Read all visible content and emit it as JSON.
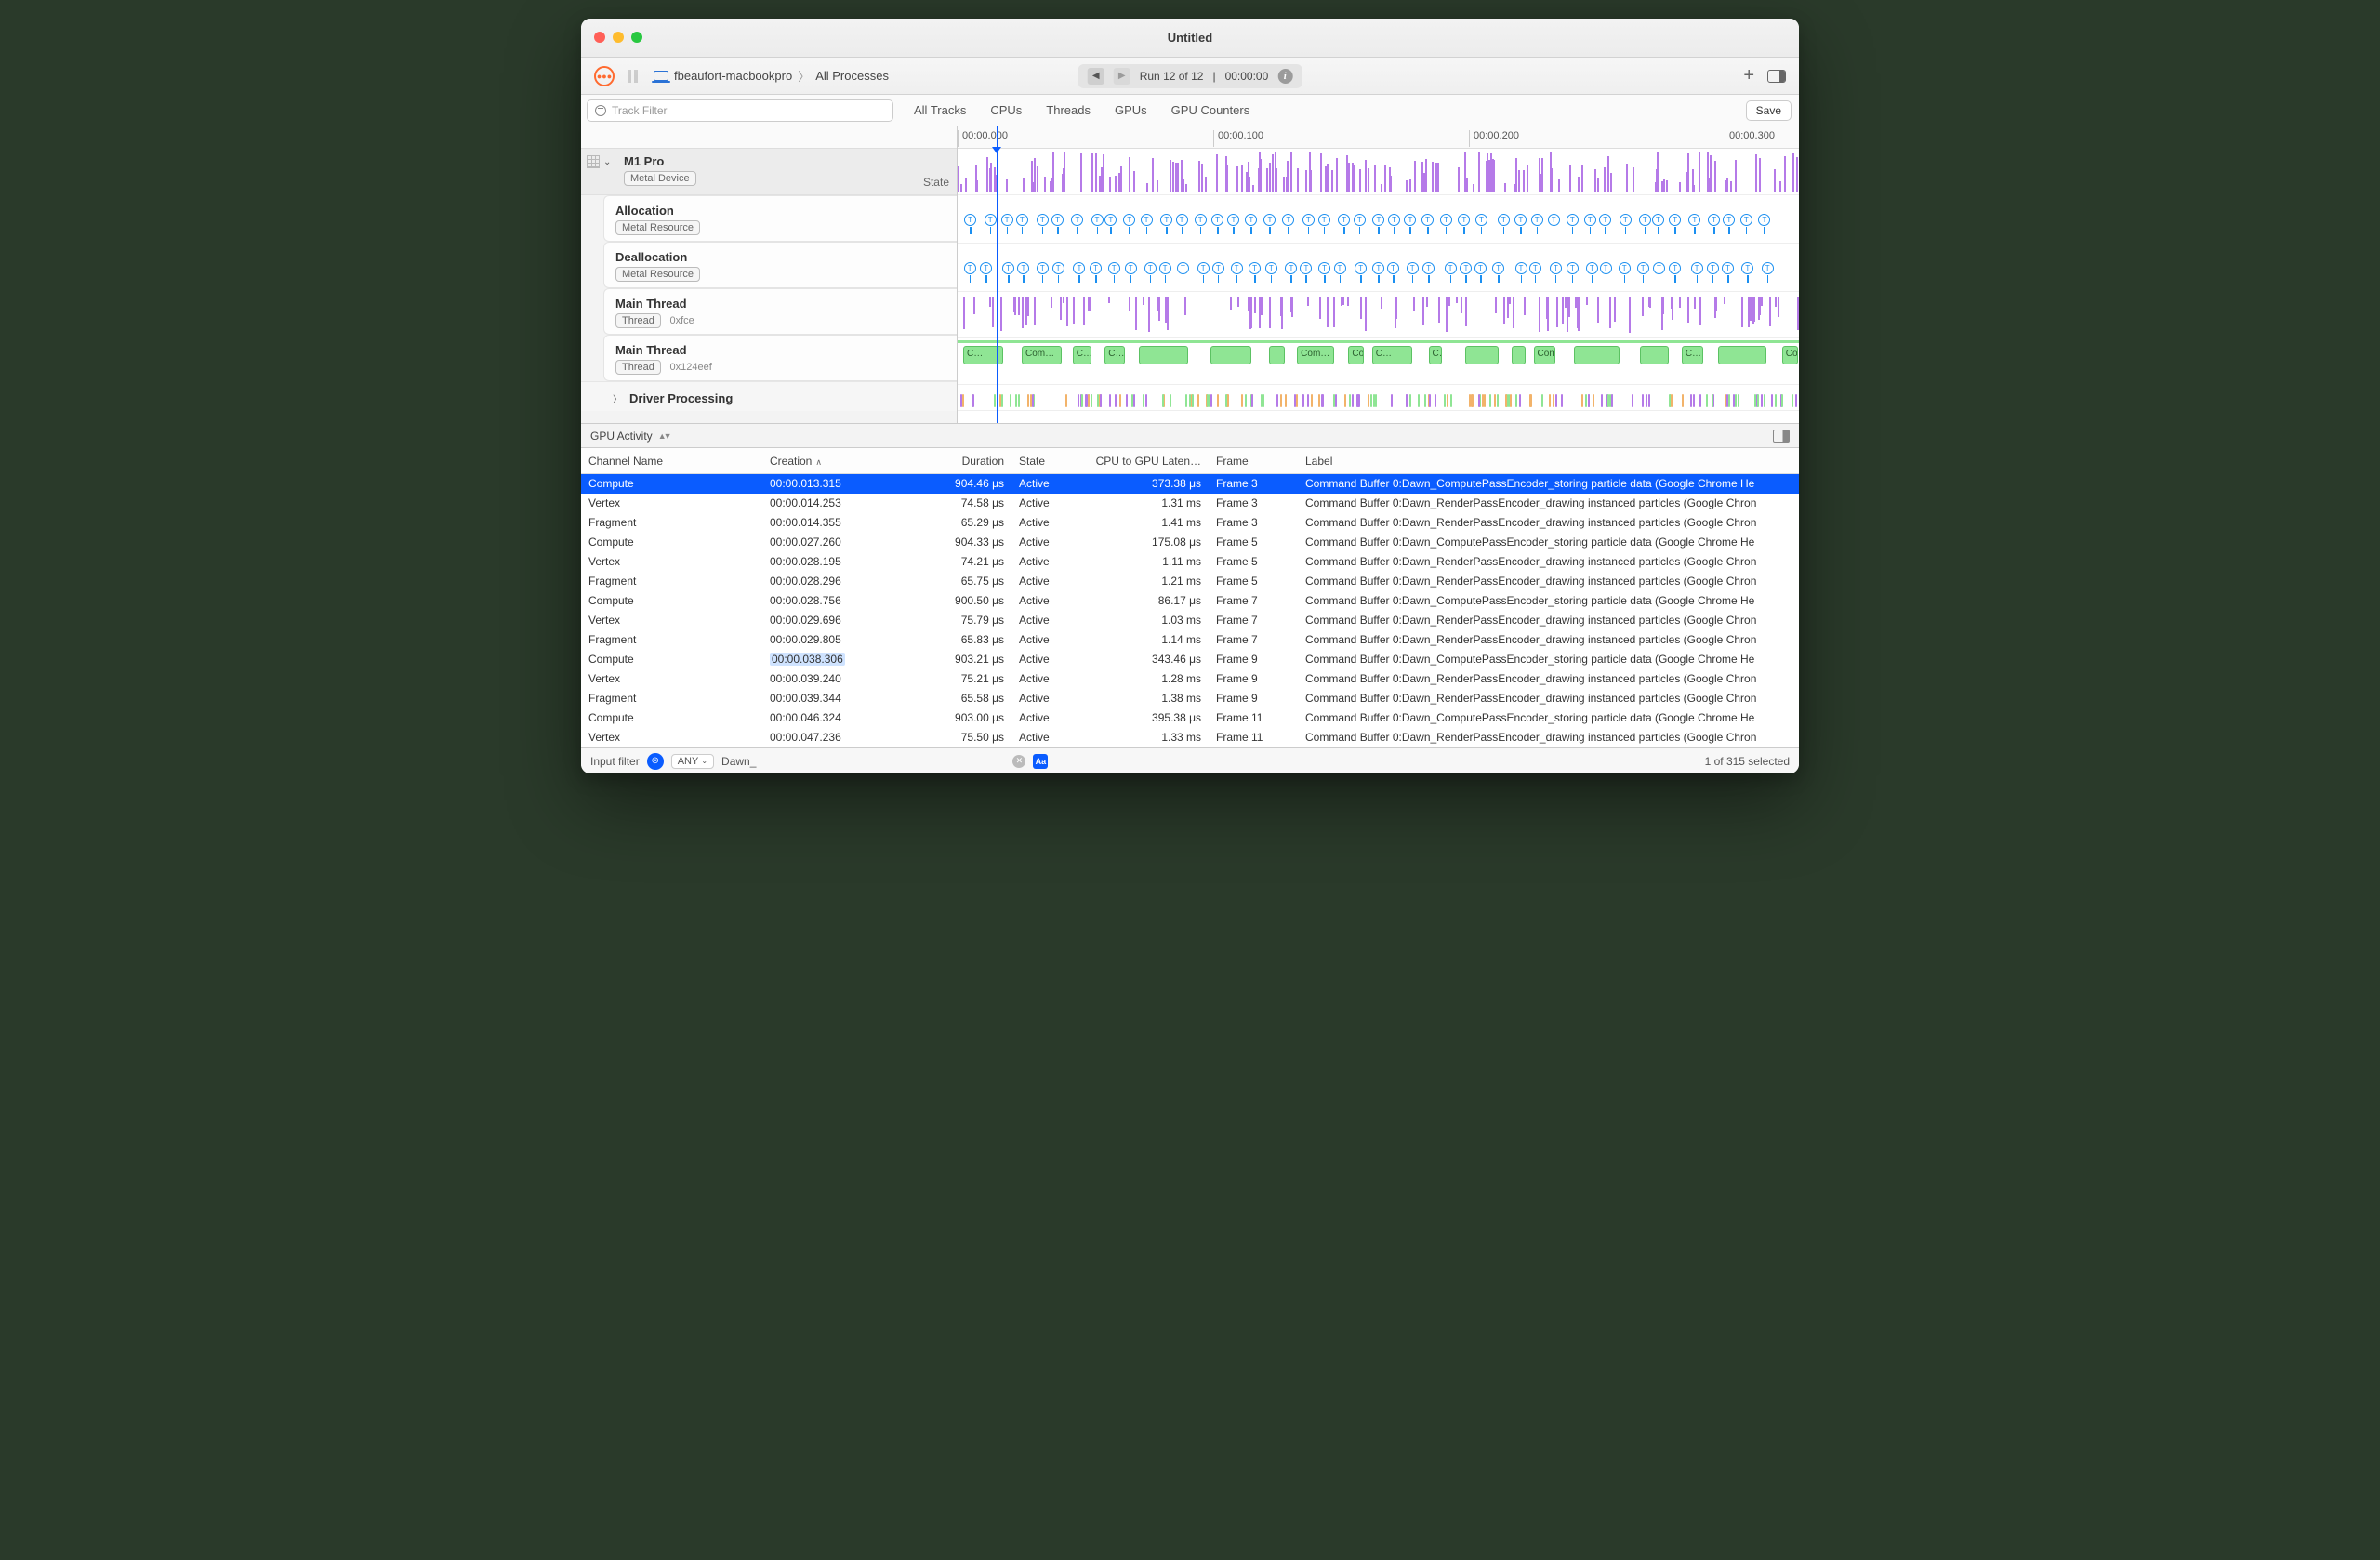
{
  "window": {
    "title": "Untitled"
  },
  "toolbar": {
    "machine": "fbeaufort-macbookpro",
    "scope": "All Processes",
    "run_label": "Run 12 of 12",
    "run_time": "00:00:00",
    "plus": "+"
  },
  "filterbar": {
    "placeholder": "Track Filter",
    "tabs": [
      "All Tracks",
      "CPUs",
      "Threads",
      "GPUs",
      "GPU Counters"
    ],
    "save": "Save"
  },
  "ruler": {
    "ticks": [
      "00:00.000",
      "00:00.100",
      "00:00.200",
      "00:00.300"
    ]
  },
  "sidebar": {
    "device": "M1 Pro",
    "device_pill": "Metal Device",
    "state": "State",
    "tracks": [
      {
        "title": "Allocation",
        "pill": "Metal Resource"
      },
      {
        "title": "Deallocation",
        "pill": "Metal Resource"
      },
      {
        "title": "Main Thread",
        "pill": "Thread",
        "sub": "0xfce"
      },
      {
        "title": "Main Thread",
        "pill": "Thread",
        "sub": "0x124eef"
      }
    ],
    "driver": "Driver Processing"
  },
  "selector": {
    "label": "GPU Activity"
  },
  "columns": {
    "channel": "Channel Name",
    "creation": "Creation",
    "duration": "Duration",
    "state": "State",
    "latency": "CPU to GPU Laten…",
    "frame": "Frame",
    "label": "Label"
  },
  "rows": [
    {
      "ch": "Compute",
      "cr": "00:00.013.315",
      "du": "904.46 μs",
      "st": "Active",
      "la": "373.38 μs",
      "fr": "Frame 3",
      "lb": "Command Buffer 0:Dawn_ComputePassEncoder_storing particle data   (Google Chrome He",
      "sel": true
    },
    {
      "ch": "Vertex",
      "cr": "00:00.014.253",
      "du": "74.58 μs",
      "st": "Active",
      "la": "1.31 ms",
      "fr": "Frame 3",
      "lb": "Command Buffer 0:Dawn_RenderPassEncoder_drawing instanced particles   (Google Chron"
    },
    {
      "ch": "Fragment",
      "cr": "00:00.014.355",
      "du": "65.29 μs",
      "st": "Active",
      "la": "1.41 ms",
      "fr": "Frame 3",
      "lb": "Command Buffer 0:Dawn_RenderPassEncoder_drawing instanced particles   (Google Chron"
    },
    {
      "ch": "Compute",
      "cr": "00:00.027.260",
      "du": "904.33 μs",
      "st": "Active",
      "la": "175.08 μs",
      "fr": "Frame 5",
      "lb": "Command Buffer 0:Dawn_ComputePassEncoder_storing particle data   (Google Chrome He"
    },
    {
      "ch": "Vertex",
      "cr": "00:00.028.195",
      "du": "74.21 μs",
      "st": "Active",
      "la": "1.11 ms",
      "fr": "Frame 5",
      "lb": "Command Buffer 0:Dawn_RenderPassEncoder_drawing instanced particles   (Google Chron"
    },
    {
      "ch": "Fragment",
      "cr": "00:00.028.296",
      "du": "65.75 μs",
      "st": "Active",
      "la": "1.21 ms",
      "fr": "Frame 5",
      "lb": "Command Buffer 0:Dawn_RenderPassEncoder_drawing instanced particles   (Google Chron"
    },
    {
      "ch": "Compute",
      "cr": "00:00.028.756",
      "du": "900.50 μs",
      "st": "Active",
      "la": "86.17 μs",
      "fr": "Frame 7",
      "lb": "Command Buffer 0:Dawn_ComputePassEncoder_storing particle data   (Google Chrome He"
    },
    {
      "ch": "Vertex",
      "cr": "00:00.029.696",
      "du": "75.79 μs",
      "st": "Active",
      "la": "1.03 ms",
      "fr": "Frame 7",
      "lb": "Command Buffer 0:Dawn_RenderPassEncoder_drawing instanced particles   (Google Chron"
    },
    {
      "ch": "Fragment",
      "cr": "00:00.029.805",
      "du": "65.83 μs",
      "st": "Active",
      "la": "1.14 ms",
      "fr": "Frame 7",
      "lb": "Command Buffer 0:Dawn_RenderPassEncoder_drawing instanced particles   (Google Chron"
    },
    {
      "ch": "Compute",
      "cr": "00:00.038.306",
      "du": "903.21 μs",
      "st": "Active",
      "la": "343.46 μs",
      "fr": "Frame 9",
      "lb": "Command Buffer 0:Dawn_ComputePassEncoder_storing particle data   (Google Chrome He",
      "hl": true
    },
    {
      "ch": "Vertex",
      "cr": "00:00.039.240",
      "du": "75.21 μs",
      "st": "Active",
      "la": "1.28 ms",
      "fr": "Frame 9",
      "lb": "Command Buffer 0:Dawn_RenderPassEncoder_drawing instanced particles   (Google Chron"
    },
    {
      "ch": "Fragment",
      "cr": "00:00.039.344",
      "du": "65.58 μs",
      "st": "Active",
      "la": "1.38 ms",
      "fr": "Frame 9",
      "lb": "Command Buffer 0:Dawn_RenderPassEncoder_drawing instanced particles   (Google Chron"
    },
    {
      "ch": "Compute",
      "cr": "00:00.046.324",
      "du": "903.00 μs",
      "st": "Active",
      "la": "395.38 μs",
      "fr": "Frame 11",
      "lb": "Command Buffer 0:Dawn_ComputePassEncoder_storing particle data   (Google Chrome He"
    },
    {
      "ch": "Vertex",
      "cr": "00:00.047.236",
      "du": "75.50 μs",
      "st": "Active",
      "la": "1.33 ms",
      "fr": "Frame 11",
      "lb": "Command Buffer 0:Dawn_RenderPassEncoder_drawing instanced particles   (Google Chron"
    }
  ],
  "footer": {
    "input_label": "Input filter",
    "any": "ANY",
    "query": "Dawn_",
    "status": "1 of 315 selected"
  }
}
